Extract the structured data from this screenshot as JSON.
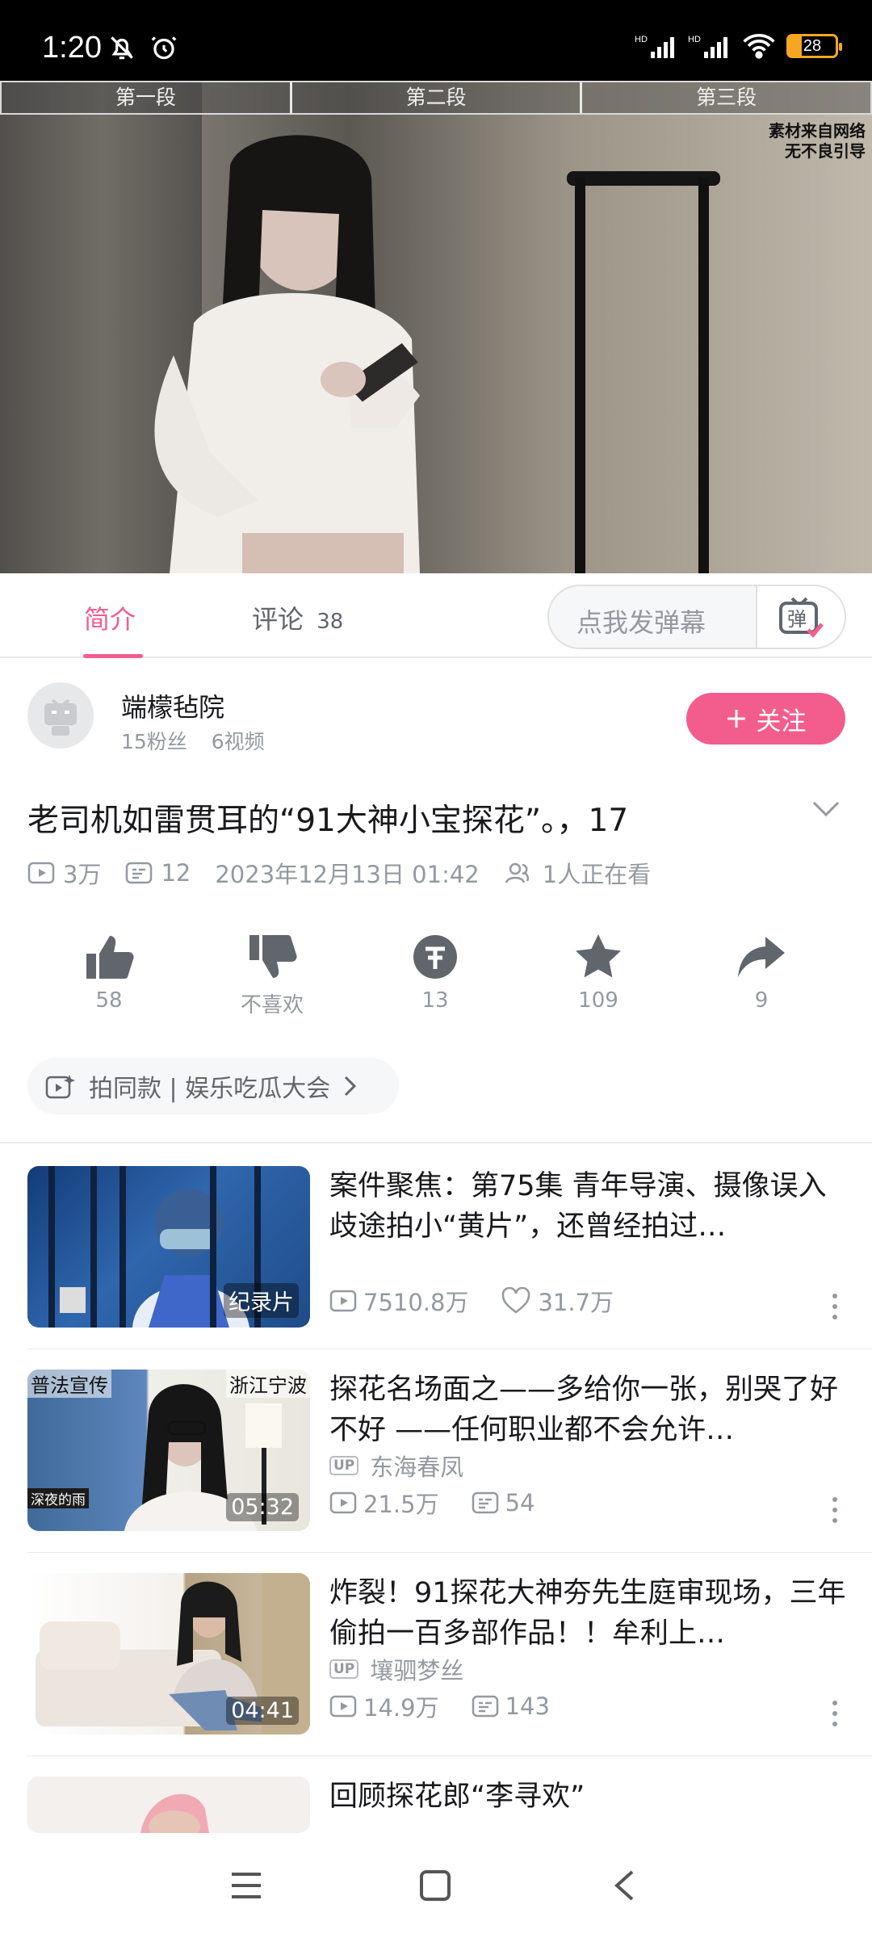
{
  "status": {
    "time": "1:20",
    "battery": "28"
  },
  "video": {
    "segments": [
      "第一段",
      "第二段",
      "第三段"
    ],
    "watermark_line1": "素材来自网络",
    "watermark_line2": "无不良引导"
  },
  "tabs": {
    "intro": "简介",
    "comments_label": "评论",
    "comments_count": "38",
    "danmaku_placeholder": "点我发弹幕",
    "danmaku_icon_char": "弹"
  },
  "uploader": {
    "name": "端檬毡院",
    "fans": "15粉丝",
    "videos": "6视频",
    "follow_label": "关注"
  },
  "video_info": {
    "title": "老司机如雷贯耳的“91大神小宝探花”。，17",
    "views": "3万",
    "danmaku": "12",
    "date": "2023年12月13日 01:42",
    "watching": "1人正在看"
  },
  "actions": {
    "like": "58",
    "dislike": "不喜欢",
    "coin": "13",
    "favorite": "109",
    "share": "9"
  },
  "tag": {
    "label": "拍同款 | 娱乐吃瓜大会"
  },
  "recommendations": [
    {
      "title": "案件聚焦：第75集 青年导演、摄像误入歧途拍小“黄片”，还曾经拍过…",
      "badge": "纪录片",
      "views": "7510.8万",
      "likes": "31.7万"
    },
    {
      "title": "探花名场面之——多给你一张，别哭了好不好 ——任何职业都不会允许…",
      "badge": "05:32",
      "uploader": "东海春凤",
      "views": "21.5万",
      "danmaku": "54",
      "thumb_left": "普法宣传",
      "thumb_right": "浙江宁波",
      "thumb_bottom": "深夜的雨"
    },
    {
      "title": "炸裂！91探花大神夯先生庭审现场，三年偷拍一百多部作品！！牟利上…",
      "badge": "04:41",
      "uploader": "壤驷梦丝",
      "views": "14.9万",
      "danmaku": "143"
    },
    {
      "title": "回顾探花郎“李寻欢”"
    }
  ],
  "up_badge": "UP",
  "colors": {
    "accent": "#f25d8e",
    "muted": "#9499a0"
  }
}
